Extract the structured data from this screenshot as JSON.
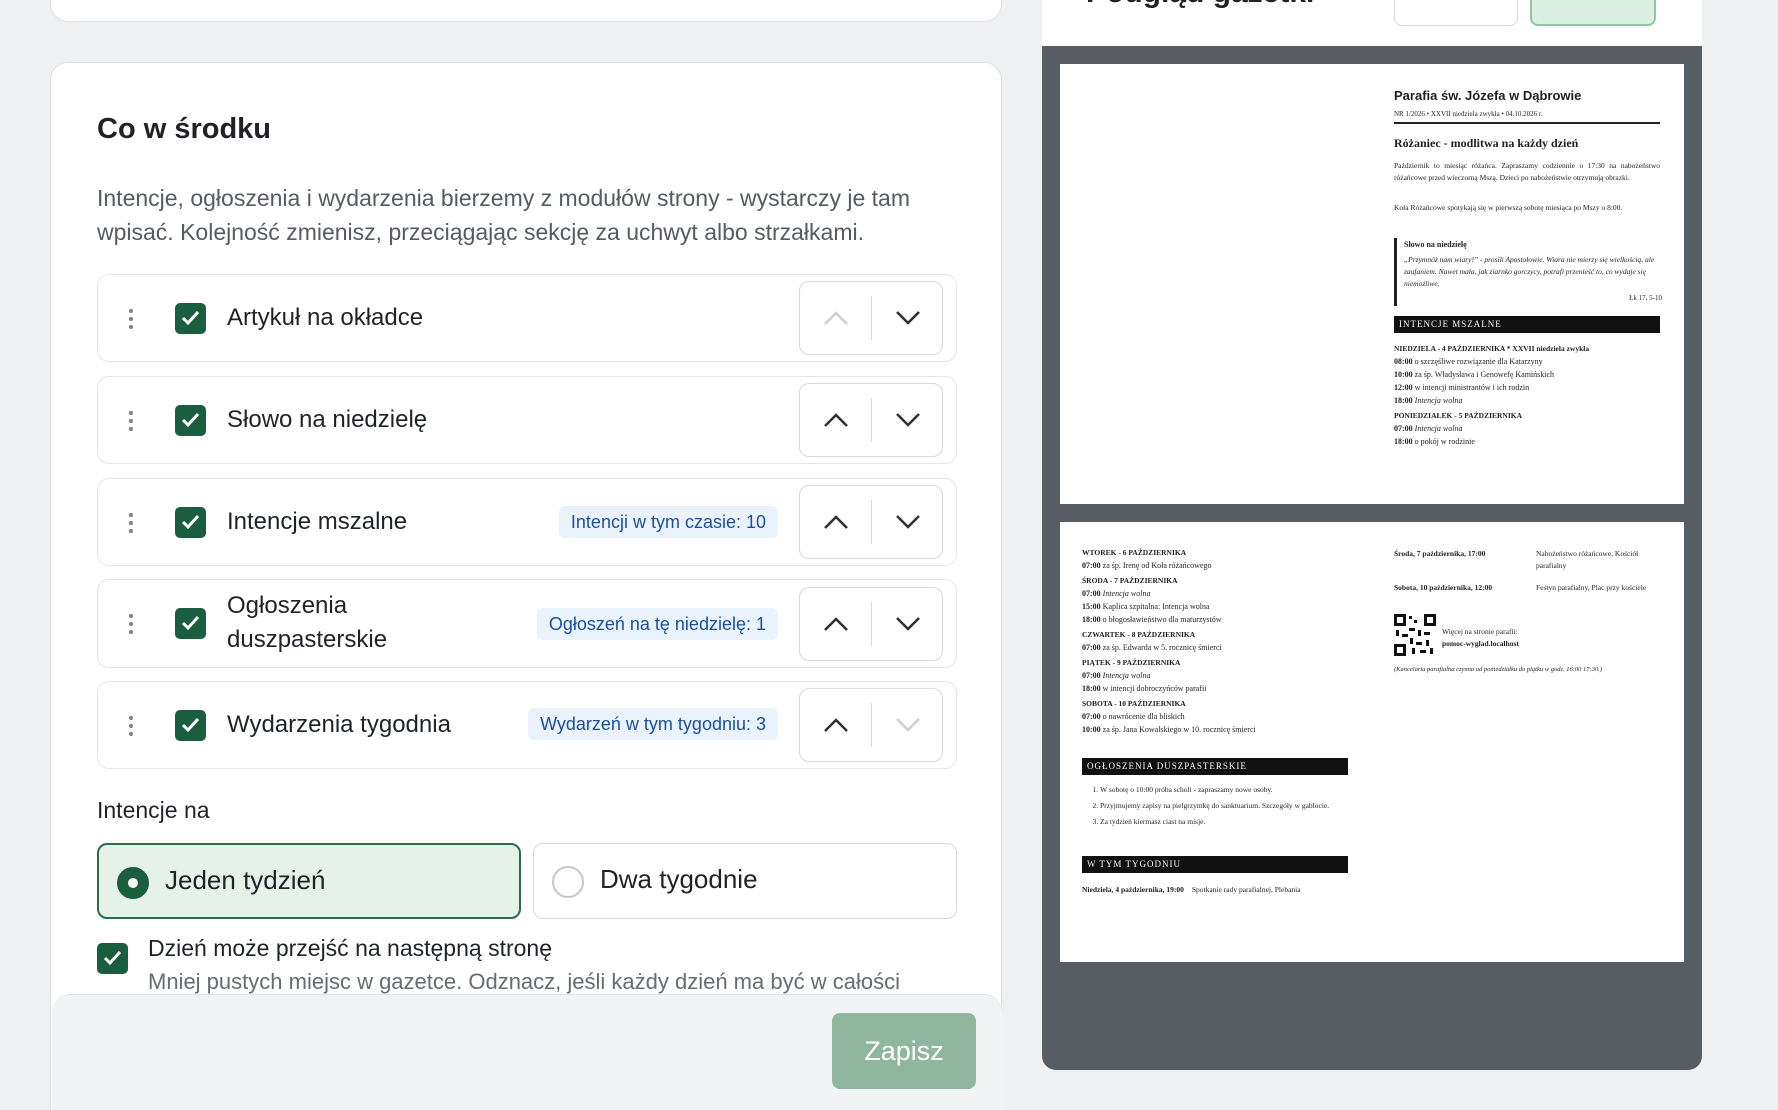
{
  "section": {
    "title": "Co w środku",
    "description": "Intencje, ogłoszenia i wydarzenia bierzemy z modułów strony - wystarczy je tam wpisać. Kolejność zmienisz, przeciągając sekcję za uchwyt albo strzałkami."
  },
  "sections_list": [
    {
      "label": "Artykuł na okładce",
      "checked": true,
      "badge": null
    },
    {
      "label": "Słowo na niedzielę",
      "checked": true,
      "badge": null
    },
    {
      "label": "Intencje mszalne",
      "checked": true,
      "badge": "Intencji w tym czasie: 10"
    },
    {
      "label": "Ogłoszenia duszpasterskie",
      "checked": true,
      "badge": "Ogłoszeń na tę niedzielę: 1"
    },
    {
      "label": "Wydarzenia tygodnia",
      "checked": true,
      "badge": "Wydarzeń w tym tygodniu: 3"
    }
  ],
  "intentions": {
    "label": "Intencje na",
    "options": [
      "Jeden tydzień",
      "Dwa tygodnie"
    ],
    "selected": "Jeden tydzień"
  },
  "day_split": {
    "label": "Dzień może przejść na następną stronę",
    "description": "Mniej pustych miejsc w gazetce. Odznacz, jeśli każdy dzień ma być w całości",
    "checked": true
  },
  "footer": {
    "save_label": "Zapisz"
  },
  "preview": {
    "title": "Podgląd gazetki"
  },
  "newsletter": {
    "parish": "Parafia św. Józefa w Dąbrowie",
    "issue_line": "NR 1/2026  •  XXVII niedziela zwykła  •  04.10.2026 r.",
    "article_title": "Różaniec - modlitwa na każdy dzień",
    "article_p1": "Październik to miesiąc różańca. Zapraszamy codziennie o 17:30 na nabożeństwo różańcowe przed wieczorną Mszą. Dzieci po nabożeństwie otrzymują obrazki.",
    "article_p2": "Koła Różańcowe spotykają się w pierwszą sobotę miesiąca po Mszy o 8:00.",
    "word_title": "Słowo na niedzielę",
    "word_text": "„Przymnóż nam wiary!” - prosili Apostołowie. Wiara nie mierzy się wielkością, ale zaufaniem. Nawet mała, jak ziarnko gorczycy, potrafi przenieść to, co wydaje się niemożliwe.",
    "word_ref": "Łk 17, 5-10",
    "intentions_header": "INTENCJE MSZALNE",
    "days_page1": [
      {
        "day": "NIEDZIELA - 4 PAŹDZIERNIKA * XXVII niedziela zwykła",
        "entries": [
          {
            "time": "08:00",
            "text": "o szczęśliwe rozwiązanie dla Katarzyny"
          },
          {
            "time": "10:00",
            "text": "za śp. Władysława i Genowefę Kamińskich"
          },
          {
            "time": "12:00",
            "text": "w intencji ministrantów i ich rodzin"
          },
          {
            "time": "18:00",
            "text": "Intencja wolna"
          }
        ]
      },
      {
        "day": "PONIEDZIAŁEK - 5 PAŹDZIERNIKA",
        "entries": [
          {
            "time": "07:00",
            "text": "Intencja wolna"
          },
          {
            "time": "18:00",
            "text": "o pokój w rodzinie"
          }
        ]
      }
    ],
    "days_page2": [
      {
        "day": "WTOREK - 6 PAŹDZIERNIKA",
        "entries": [
          {
            "time": "07:00",
            "text": "za śp. Irenę od Koła różańcowego"
          }
        ]
      },
      {
        "day": "ŚRODA - 7 PAŹDZIERNIKA",
        "entries": [
          {
            "time": "07:00",
            "text": "Intencja wolna"
          },
          {
            "time": "15:00",
            "text": "Kaplica szpitalna: Intencja wolna"
          },
          {
            "time": "18:00",
            "text": "o błogosławieństwo dla maturzystów"
          }
        ]
      },
      {
        "day": "CZWARTEK - 8 PAŹDZIERNIKA",
        "entries": [
          {
            "time": "07:00",
            "text": "za śp. Edwarda w 5. rocznicę śmierci"
          }
        ]
      },
      {
        "day": "PIĄTEK - 9 PAŹDZIERNIKA",
        "entries": [
          {
            "time": "07:00",
            "text": "Intencja wolna"
          },
          {
            "time": "18:00",
            "text": "w intencji dobroczyńców parafii"
          }
        ]
      },
      {
        "day": "SOBOTA - 10 PAŹDZIERNIKA",
        "entries": [
          {
            "time": "07:00",
            "text": "o nawrócenie dla bliskich"
          },
          {
            "time": "10:00",
            "text": "za śp. Jana Kowalskiego w 10. rocznicę śmierci"
          }
        ]
      }
    ],
    "announcements_header": "OGŁOSZENIA DUSZPASTERSKIE",
    "announcements": [
      "W sobotę o 10:00 próba scholi - zapraszamy nowe osoby.",
      "Przyjmujemy zapisy na pielgrzymkę do sanktuarium. Szczegóły w gablocie.",
      "Za tydzień kiermasz ciast na misje."
    ],
    "week_header": "W TYM TYGODNIU",
    "week_events_left": [
      {
        "when": "Niedziela, 4 października, 19:00",
        "what": "Spotkanie rady parafialnej, Plebania"
      }
    ],
    "week_events_right": [
      {
        "when": "Środa, 7 października, 17:00",
        "what": "Nabożeństwo różańcowe, Kościół parafialny"
      },
      {
        "when": "Sobota, 10 października, 12:00",
        "what": "Festyn parafialny, Plac przy kościele"
      }
    ],
    "qr_text_1": "Więcej na stronie parafii:",
    "qr_text_2": "pomoc-wyglad.localhost",
    "office_note": "(Kancelaria parafialna czynna od poniedziałku do piątku w godz. 16:00 17:30.)"
  },
  "colors": {
    "accent": "#1b5e3f",
    "badge_bg": "#eaf2fc",
    "badge_text": "#1c4f9c",
    "save_button": "#8fb79e",
    "preview_bg": "#575d62"
  }
}
